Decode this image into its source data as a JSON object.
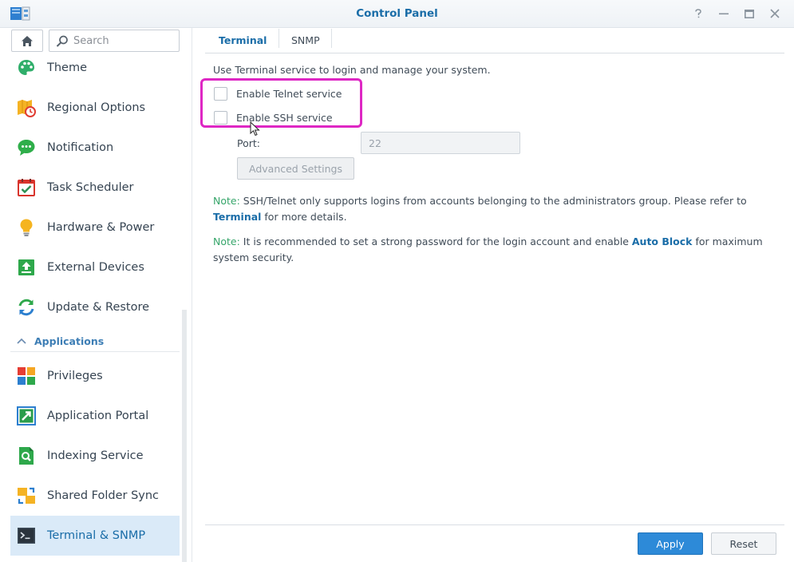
{
  "window": {
    "title": "Control Panel",
    "app_icon": "control-panel-icon",
    "controls": [
      "help-icon",
      "minimize-icon",
      "maximize-icon",
      "close-icon"
    ]
  },
  "sidebar": {
    "search_placeholder": "Search",
    "items": [
      {
        "label": "Theme",
        "icon": "theme-palette-icon"
      },
      {
        "label": "Regional Options",
        "icon": "regional-options-icon"
      },
      {
        "label": "Notification",
        "icon": "notification-chat-icon"
      },
      {
        "label": "Task Scheduler",
        "icon": "task-scheduler-icon"
      },
      {
        "label": "Hardware & Power",
        "icon": "lightbulb-icon"
      },
      {
        "label": "External Devices",
        "icon": "external-devices-icon"
      },
      {
        "label": "Update & Restore",
        "icon": "update-restore-icon"
      }
    ],
    "section": {
      "label": "Applications",
      "icon": "chevron-up-icon"
    },
    "app_items": [
      {
        "label": "Privileges",
        "icon": "privileges-icon"
      },
      {
        "label": "Application Portal",
        "icon": "application-portal-icon"
      },
      {
        "label": "Indexing Service",
        "icon": "indexing-service-icon"
      },
      {
        "label": "Shared Folder Sync",
        "icon": "shared-folder-sync-icon"
      },
      {
        "label": "Terminal & SNMP",
        "icon": "terminal-icon",
        "active": true
      }
    ]
  },
  "tabs": [
    {
      "label": "Terminal",
      "active": true
    },
    {
      "label": "SNMP",
      "active": false
    }
  ],
  "terminal": {
    "description": "Use Terminal service to login and manage your system.",
    "telnet": {
      "label": "Enable Telnet service",
      "checked": false
    },
    "ssh": {
      "label": "Enable SSH service",
      "checked": false
    },
    "port": {
      "label": "Port:",
      "value": "22"
    },
    "advanced_label": "Advanced Settings",
    "note1": {
      "prefix": "Note:",
      "text": " SSH/Telnet only supports logins from accounts belonging to the administrators group. Please refer to",
      "link": "Terminal",
      "suffix": " for more details."
    },
    "note2": {
      "prefix": "Note:",
      "text": " It is recommended to set a strong password for the login account and enable ",
      "link": "Auto Block",
      "suffix": " for maximum system security."
    }
  },
  "footer": {
    "apply_label": "Apply",
    "reset_label": "Reset"
  },
  "colors": {
    "accent": "#1a6da8",
    "note": "#37a66b",
    "highlight": "#de27c4",
    "apply": "#2d8ad8"
  }
}
